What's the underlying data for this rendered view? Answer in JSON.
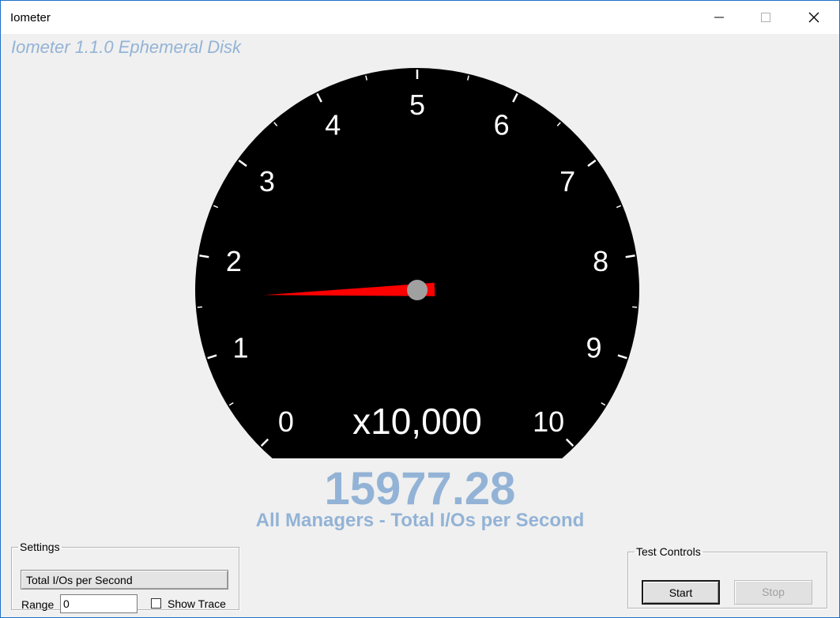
{
  "window": {
    "title": "Iometer"
  },
  "app": {
    "caption": "Iometer 1.1.0 Ephemeral Disk"
  },
  "gauge": {
    "scale_labels": [
      "0",
      "1",
      "2",
      "3",
      "4",
      "5",
      "6",
      "7",
      "8",
      "9",
      "10"
    ],
    "multiplier_label": "x10,000",
    "min": 0,
    "max": 10,
    "needle_value": 1.5977,
    "colors": {
      "dial": "#000000",
      "needle": "#ff0000",
      "hub": "#a0a0a0",
      "text": "#ffffff"
    }
  },
  "readout": {
    "value": "15977.28",
    "label": "All Managers - Total I/Os per Second",
    "color": "#93b3d6"
  },
  "settings": {
    "legend": "Settings",
    "metric_selected": "Total I/Os per Second",
    "range_label": "Range",
    "range_value": "0",
    "show_trace_label": "Show Trace",
    "show_trace_checked": false
  },
  "test_controls": {
    "legend": "Test Controls",
    "start_label": "Start",
    "stop_label": "Stop",
    "stop_enabled": false
  },
  "icons": [
    "minimize-icon",
    "maximize-icon",
    "close-icon"
  ]
}
